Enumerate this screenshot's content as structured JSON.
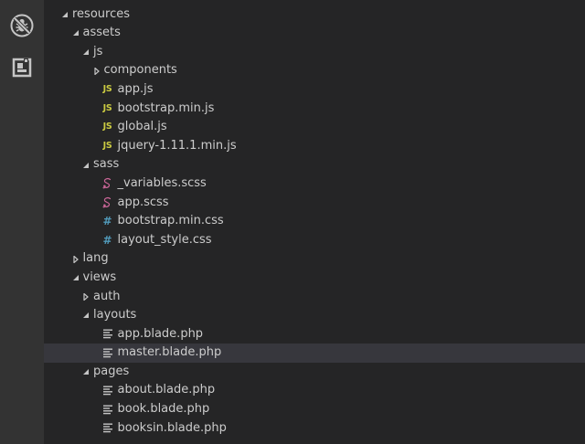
{
  "activity_bar": {
    "items": [
      {
        "icon": "debug-disabled-icon"
      },
      {
        "icon": "extensions-icon"
      }
    ]
  },
  "colors": {
    "selected_row": "#37373d",
    "js_badge": "#cbcb41",
    "css_badge": "#519aba",
    "sass_icon": "#cd6799",
    "text": "#cccccc"
  },
  "tree": [
    {
      "label": "",
      "depth": 0,
      "type": "folder",
      "expanded": true
    },
    {
      "label": "resources",
      "depth": 0,
      "type": "folder",
      "expanded": true
    },
    {
      "label": "assets",
      "depth": 1,
      "type": "folder",
      "expanded": true
    },
    {
      "label": "js",
      "depth": 2,
      "type": "folder",
      "expanded": true
    },
    {
      "label": "components",
      "depth": 3,
      "type": "folder",
      "expanded": false
    },
    {
      "label": "app.js",
      "depth": 3,
      "type": "js"
    },
    {
      "label": "bootstrap.min.js",
      "depth": 3,
      "type": "js"
    },
    {
      "label": "global.js",
      "depth": 3,
      "type": "js"
    },
    {
      "label": "jquery-1.11.1.min.js",
      "depth": 3,
      "type": "js"
    },
    {
      "label": "sass",
      "depth": 2,
      "type": "folder",
      "expanded": true
    },
    {
      "label": "_variables.scss",
      "depth": 3,
      "type": "scss"
    },
    {
      "label": "app.scss",
      "depth": 3,
      "type": "scss"
    },
    {
      "label": "bootstrap.min.css",
      "depth": 3,
      "type": "css"
    },
    {
      "label": "layout_style.css",
      "depth": 3,
      "type": "css"
    },
    {
      "label": "lang",
      "depth": 1,
      "type": "folder",
      "expanded": false
    },
    {
      "label": "views",
      "depth": 1,
      "type": "folder",
      "expanded": true
    },
    {
      "label": "auth",
      "depth": 2,
      "type": "folder",
      "expanded": false
    },
    {
      "label": "layouts",
      "depth": 2,
      "type": "folder",
      "expanded": true
    },
    {
      "label": "app.blade.php",
      "depth": 3,
      "type": "php"
    },
    {
      "label": "master.blade.php",
      "depth": 3,
      "type": "php",
      "selected": true
    },
    {
      "label": "pages",
      "depth": 2,
      "type": "folder",
      "expanded": true
    },
    {
      "label": "about.blade.php",
      "depth": 3,
      "type": "php"
    },
    {
      "label": "book.blade.php",
      "depth": 3,
      "type": "php"
    },
    {
      "label": "booksin.blade.php",
      "depth": 3,
      "type": "php"
    }
  ]
}
